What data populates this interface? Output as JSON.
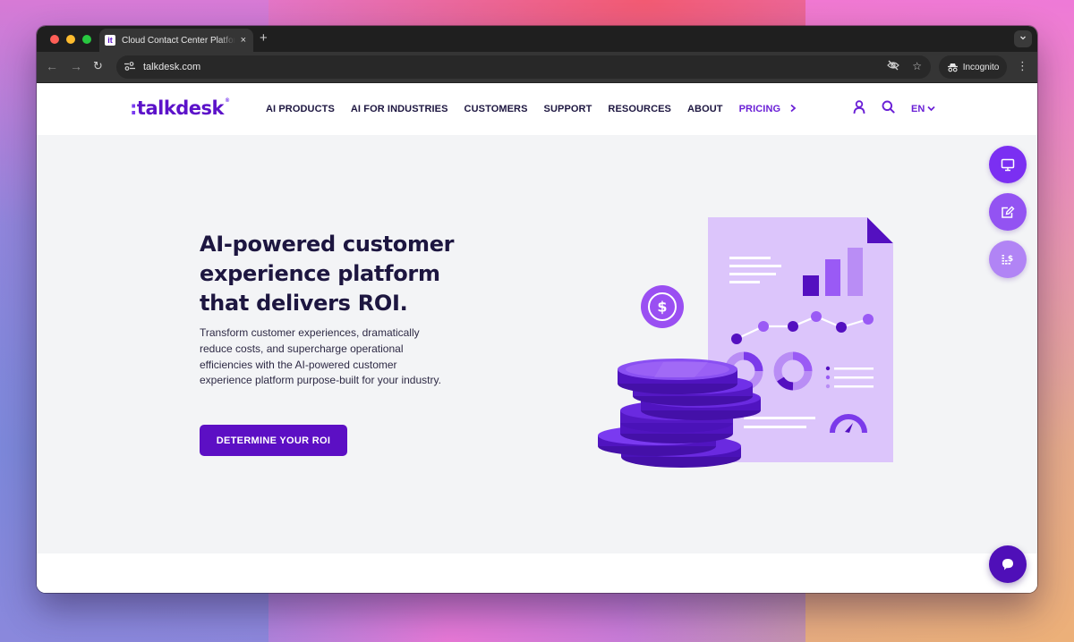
{
  "browser": {
    "tab": {
      "favicon": "it",
      "title": "Cloud Contact Center Platform",
      "close_icon": "×"
    },
    "new_tab_icon": "+",
    "tab_menu_icon": "⌄",
    "nav": {
      "back_icon": "←",
      "forward_icon": "→",
      "reload_icon": "↻"
    },
    "address_bar": {
      "site_info_icon": "⚯",
      "url": "talkdesk.com"
    },
    "toolbar_icons": {
      "eye_off_icon": "👁",
      "star_icon": "☆"
    },
    "incognito_label": "Incognito",
    "menu_icon": "⋮"
  },
  "site": {
    "logo": {
      "prefix": ":",
      "text": "talkdesk",
      "mark": "®"
    },
    "nav": [
      {
        "label": "AI PRODUCTS"
      },
      {
        "label": "AI FOR INDUSTRIES"
      },
      {
        "label": "CUSTOMERS"
      },
      {
        "label": "SUPPORT"
      },
      {
        "label": "RESOURCES"
      },
      {
        "label": "ABOUT"
      },
      {
        "label": "PRICING"
      }
    ],
    "nav_more_icon": "›",
    "language": "EN",
    "language_chevron": "⌄",
    "colors": {
      "brand": "#5c0fc4",
      "accent": "#6a1fd6",
      "heading": "#1d1640",
      "hero_bg": "#f3f4f6"
    }
  },
  "hero": {
    "title": "AI-powered customer experience platform that delivers ROI.",
    "description": "Transform customer experiences, dramatically reduce costs, and supercharge operational efficiencies with the AI-powered customer experience platform purpose-built for your industry.",
    "cta_label": "DETERMINE YOUR ROI",
    "illustration": {
      "dollar_icon": "$"
    }
  },
  "floating_actions": [
    {
      "name": "demo",
      "icon": "monitor-icon"
    },
    {
      "name": "quote",
      "icon": "edit-icon"
    },
    {
      "name": "pricing",
      "icon": "pricing-icon"
    },
    {
      "name": "chat",
      "icon": "chat-icon"
    }
  ]
}
